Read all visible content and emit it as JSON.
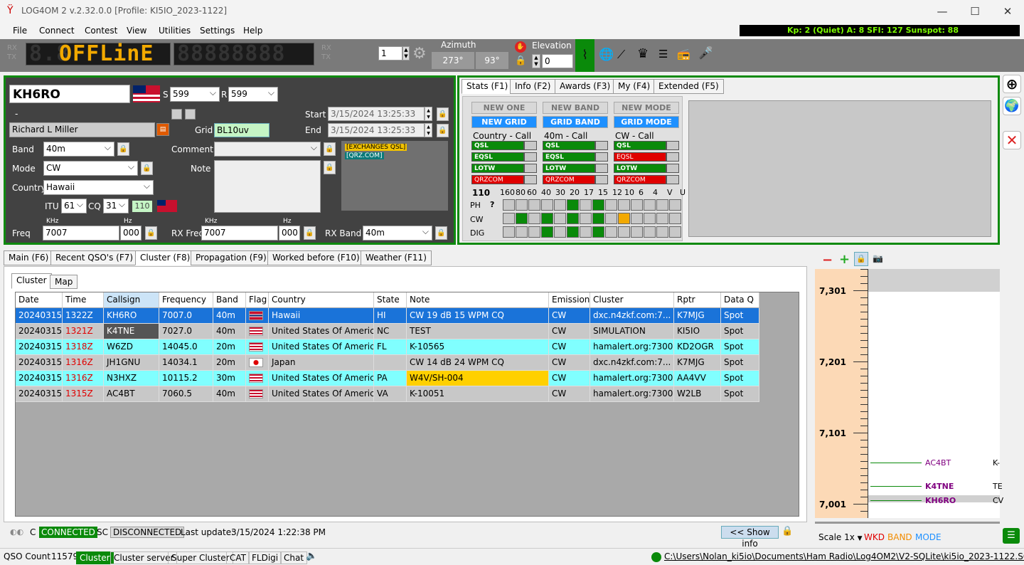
{
  "window": {
    "title": "LOG4OM 2 v.2.32.0.0 [Profile: KI5IO_2023-1122]"
  },
  "menu": [
    "File",
    "Connect",
    "Contest",
    "View",
    "Utilities",
    "Settings",
    "Help"
  ],
  "propagation": "Kp: 2 (Quiet)  A: 8  SFI: 127 Sunspot: 88",
  "radio": {
    "display": "8.8OFFLinE",
    "rx": "RX",
    "tx": "TX",
    "vfo": "1",
    "azimuth_label": "Azimuth",
    "azimuth": "273°",
    "azimuth2": "93°",
    "elevation_label": "Elevation",
    "elevation": "0"
  },
  "qso": {
    "callsign": "KH6RO",
    "s_label": "S",
    "s_value": "599",
    "r_label": "R",
    "r_value": "599",
    "dash": "-",
    "name": "Richard L Miller",
    "grid_label": "Grid",
    "grid": "BL10uv",
    "start_label": "Start",
    "start": "3/15/2024 13:25:33",
    "end_label": "End",
    "end": "3/15/2024 13:25:33",
    "band_label": "Band",
    "band": "40m",
    "comment_label": "Comment",
    "mode_label": "Mode",
    "mode": "CW",
    "note_label": "Note",
    "country_label": "Country",
    "country": "Hawaii",
    "itu_label": "ITU",
    "itu": "61",
    "cq_label": "CQ",
    "cq": "31",
    "dxcc_num": "110",
    "khz": "KHz",
    "hz": "Hz",
    "freq_label": "Freq",
    "freq": "7007",
    "freq_hz": "000",
    "rxfreq_label": "RX Freq",
    "rxfreq": "7007",
    "rxfreq_hz": "000",
    "rxband_label": "RX Band",
    "rxband": "40m",
    "tag1": "[EXCHANGES QSL]",
    "tag2": "[QRZ.COM]"
  },
  "stats_tabs": [
    "Stats (F1)",
    "Info (F2)",
    "Awards (F3)",
    "My (F4)",
    "Extended (F5)"
  ],
  "stats": {
    "new_one": "NEW ONE",
    "new_band": "NEW BAND",
    "new_mode": "NEW MODE",
    "new_grid": "NEW GRID",
    "grid_band": "GRID BAND",
    "grid_mode": "GRID MODE",
    "col1_title": "Country - Call",
    "col2_title": "40m - Call",
    "col3_title": "CW - Call",
    "qsl": "QSL",
    "eqsl": "EQSL",
    "lotw": "LOTW",
    "qrzcom": "QRZCOM",
    "dxcc": "110",
    "bands": [
      "160",
      "80",
      "60",
      "40",
      "30",
      "20",
      "17",
      "15",
      "12",
      "10",
      "6",
      "4",
      "V",
      "U"
    ],
    "ph": "PH",
    "cw": "CW",
    "dig": "DIG",
    "help": "?"
  },
  "main_tabs": [
    "Main (F6)",
    "Recent QSO's (F7)",
    "Cluster (F8)",
    "Propagation (F9)",
    "Worked before (F10)",
    "Weather (F11)"
  ],
  "sub_tabs": [
    "Cluster",
    "Map"
  ],
  "table": {
    "headers": [
      "Date",
      "Time",
      "Callsign",
      "Frequency",
      "Band",
      "Flag",
      "Country",
      "State",
      "Note",
      "Emission",
      "Cluster",
      "Rptr",
      "Data Q"
    ],
    "rows": [
      [
        "20240315",
        "1322Z",
        "KH6RO",
        "7007.0",
        "40m",
        "HI",
        "Hawaii",
        "HI",
        "CW 19 dB 15 WPM CQ",
        "CW",
        "dxc.n4zkf.com:7...",
        "K7MJG",
        "Spot"
      ],
      [
        "20240315",
        "1321Z",
        "K4TNE",
        "7027.0",
        "40m",
        "US",
        "United States Of America",
        "NC",
        "TEST",
        "CW",
        "SIMULATION",
        "KI5IO",
        "Spot"
      ],
      [
        "20240315",
        "1318Z",
        "W6ZD",
        "14045.0",
        "20m",
        "US",
        "United States Of America",
        "FL",
        "K-10565",
        "CW",
        "hamalert.org:7300",
        "KD2OGR",
        "Spot"
      ],
      [
        "20240315",
        "1316Z",
        "JH1GNU",
        "14034.1",
        "20m",
        "JP",
        "Japan",
        "",
        "CW 14 dB 24 WPM CQ",
        "CW",
        "dxc.n4zkf.com:7...",
        "K7MJG",
        "Spot"
      ],
      [
        "20240315",
        "1316Z",
        "N3HXZ",
        "10115.2",
        "30m",
        "US",
        "United States Of America",
        "PA",
        "W4V/SH-004",
        "CW",
        "hamalert.org:7300",
        "AA4VV",
        "Spot"
      ],
      [
        "20240315",
        "1315Z",
        "AC4BT",
        "7060.5",
        "40m",
        "US",
        "United States Of America",
        "VA",
        "K-10051",
        "CW",
        "hamalert.org:7300",
        "W2LB",
        "Spot"
      ]
    ]
  },
  "cluster_status": {
    "c": "C",
    "connected": "CONNECTED",
    "sc": "SC",
    "disconnected": "DISCONNECTED",
    "last_update_label": "Last update:",
    "last_update": "3/15/2024 1:22:38 PM",
    "show_info": "<< Show info"
  },
  "bandmap": {
    "freqs": [
      "7,301",
      "7,201",
      "7,101",
      "7,001"
    ],
    "spots": [
      {
        "call": "AC4BT",
        "note": "K-"
      },
      {
        "call": "K4TNE",
        "note": "TE"
      },
      {
        "call": "KH6RO",
        "note": "CV"
      }
    ],
    "scale": "Scale 1x",
    "wkd": "WKD",
    "band": "BAND",
    "mode": "MODE"
  },
  "statusbar": {
    "qso_count_label": "QSO Count",
    "qso_count": "11579",
    "items": [
      "Cluster",
      "Cluster server",
      "Super Cluster",
      "CAT",
      "FLDigi",
      "Chat"
    ],
    "path": "C:\\Users\\Nolan_ki5io\\Documents\\Ham Radio\\Log4OM2\\V2-SQLite\\ki5io_2023-1122.SQLite"
  }
}
